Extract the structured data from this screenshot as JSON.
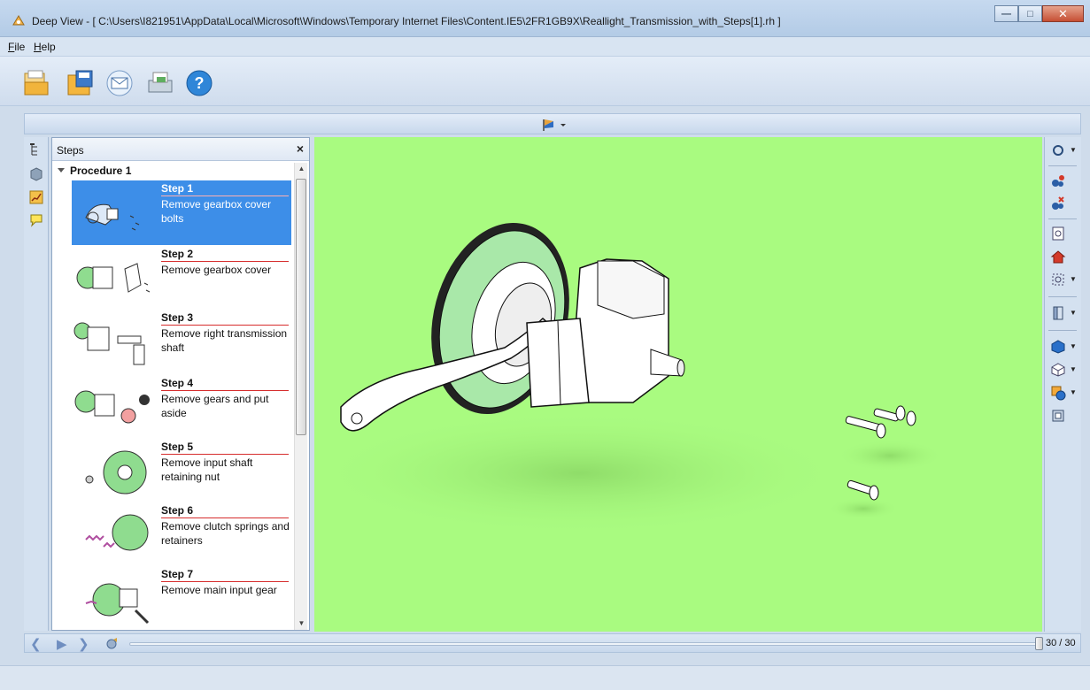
{
  "window": {
    "title": "Deep View - [ C:\\Users\\I821951\\AppData\\Local\\Microsoft\\Windows\\Temporary Internet Files\\Content.IE5\\2FR1GB9X\\Reallight_Transmission_with_Steps[1].rh ]",
    "minimize": "—",
    "maximize": "□",
    "close": "✕"
  },
  "menu": {
    "file": "File",
    "help": "Help"
  },
  "toolbar": {
    "icons": [
      "open-icon",
      "save-icon",
      "email-icon",
      "print-icon",
      "help-icon"
    ]
  },
  "steps_panel": {
    "title": "Steps",
    "close": "×",
    "procedure": "Procedure 1",
    "steps": [
      {
        "title": "Step 1",
        "desc": "Remove gearbox cover bolts"
      },
      {
        "title": "Step 2",
        "desc": "Remove gearbox cover"
      },
      {
        "title": "Step 3",
        "desc": "Remove right transmission shaft"
      },
      {
        "title": "Step 4",
        "desc": "Remove gears and put aside"
      },
      {
        "title": "Step 5",
        "desc": "Remove input shaft retaining nut"
      },
      {
        "title": "Step 6",
        "desc": "Remove clutch springs and retainers"
      },
      {
        "title": "Step 7",
        "desc": "Remove main input gear"
      }
    ],
    "selected_index": 0
  },
  "playback": {
    "count": "30 / 30",
    "position_fraction": 1.0
  },
  "colors": {
    "viewport_bg": "#a9fb80",
    "selection": "#3d8ee8",
    "step_underline": "#d62d2d"
  }
}
